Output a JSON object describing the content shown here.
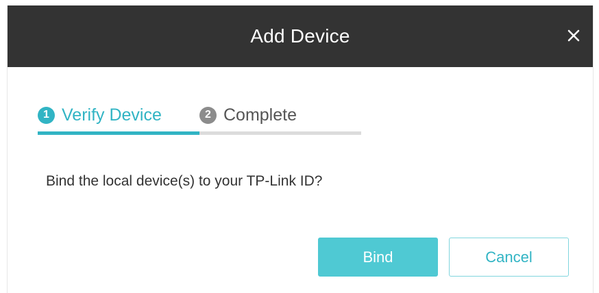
{
  "dialog": {
    "title": "Add Device",
    "close_icon": "close-icon"
  },
  "steps": [
    {
      "number": "1",
      "label": "Verify Device",
      "state": "active",
      "color": "#31b4c4"
    },
    {
      "number": "2",
      "label": "Complete",
      "state": "inactive",
      "color": "#8c8c8c"
    }
  ],
  "progress": {
    "completed_fraction": 0.5,
    "accent_color": "#31b4c4"
  },
  "message": "Bind the local device(s) to your TP-Link ID?",
  "buttons": {
    "bind_label": "Bind",
    "cancel_label": "Cancel"
  },
  "colors": {
    "titlebar": "#333333",
    "accent": "#31b4c4",
    "bind_button": "#4fc9d3"
  }
}
